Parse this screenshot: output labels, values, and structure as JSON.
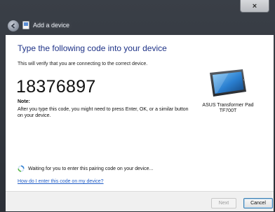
{
  "window": {
    "title": "Add a device",
    "close_label": "×"
  },
  "content": {
    "heading": "Type the following code into your device",
    "subtext": "This will verify that you are connecting to the correct device.",
    "pairing_code": "18376897",
    "note_label": "Note:",
    "note_text": "After you type this code, you might need to press Enter, OK, or a similar button on your device.",
    "device_name": "ASUS Transformer Pad TF700T",
    "device_icon": "tablet-device-icon",
    "status_text": "Waiting for you to enter this pairing code on your device...",
    "help_link": "How do I enter this code on my device?"
  },
  "footer": {
    "next_label": "Next",
    "cancel_label": "Cancel"
  }
}
